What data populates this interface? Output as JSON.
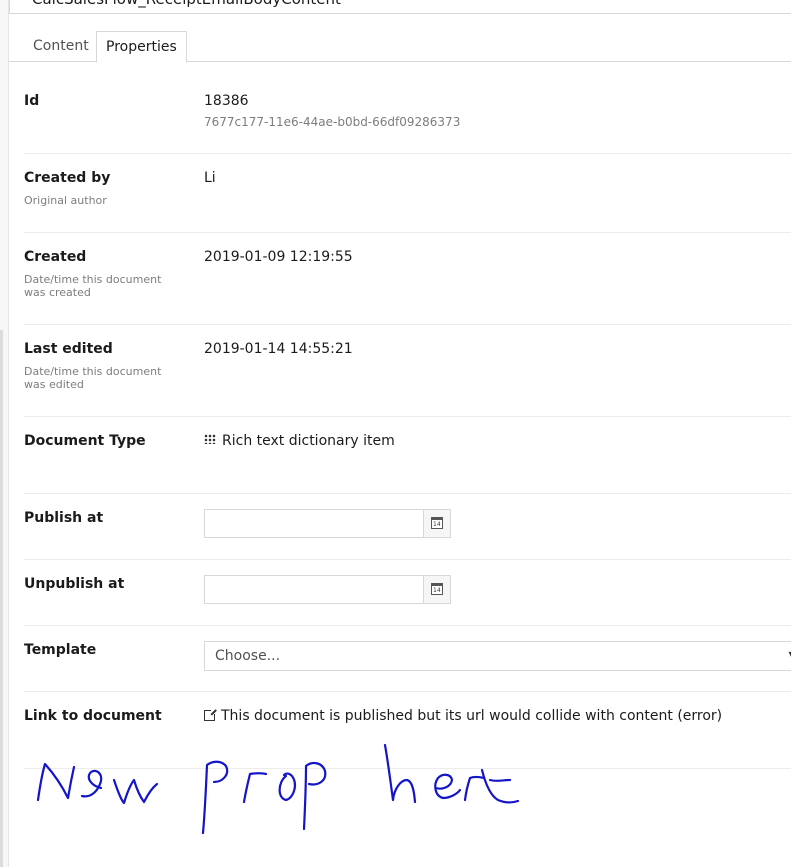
{
  "document": {
    "name": "CalcSalesFlow_ReceiptEmailBodyContent"
  },
  "tabs": [
    {
      "label": "Content"
    },
    {
      "label": "Properties"
    }
  ],
  "properties": {
    "id": {
      "label": "Id",
      "value": "18386",
      "guid": "7677c177-11e6-44ae-b0bd-66df09286373"
    },
    "created_by": {
      "label": "Created by",
      "description": "Original author",
      "value": "Li"
    },
    "created": {
      "label": "Created",
      "description": "Date/time this document was created",
      "value": "2019-01-09 12:19:55"
    },
    "last_edited": {
      "label": "Last edited",
      "description": "Date/time this document was edited",
      "value": "2019-01-14 14:55:21"
    },
    "document_type": {
      "label": "Document Type",
      "value": "Rich text dictionary item",
      "icon": "grid-dots-icon"
    },
    "publish_at": {
      "label": "Publish at",
      "value": "",
      "icon": "calendar-icon",
      "icon_text": "14"
    },
    "unpublish_at": {
      "label": "Unpublish at",
      "value": "",
      "icon": "calendar-icon",
      "icon_text": "14"
    },
    "template": {
      "label": "Template",
      "selected": "Choose..."
    },
    "link_to_document": {
      "label": "Link to document",
      "value": "This document is published but its url would collide with content (error)",
      "icon": "external-link-icon"
    }
  },
  "annotation": {
    "text": "New prop here",
    "color": "#1515c8"
  }
}
